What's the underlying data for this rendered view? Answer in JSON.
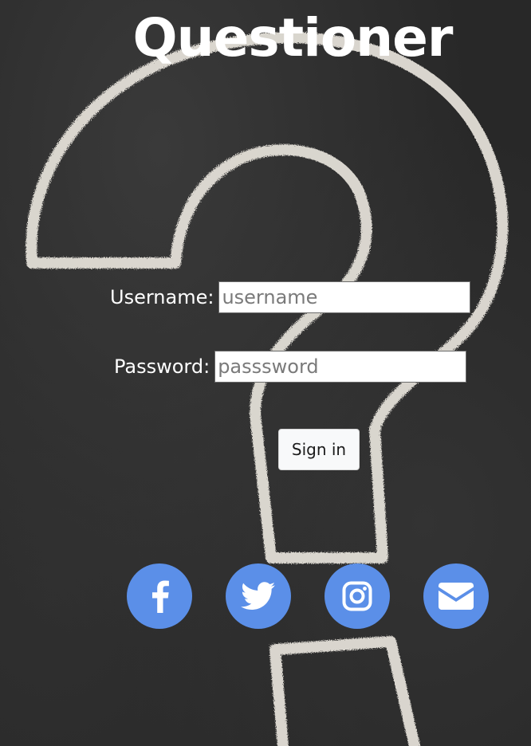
{
  "app": {
    "title": "Questioner"
  },
  "form": {
    "username_label": "Username:",
    "username_placeholder": "username",
    "username_value": "",
    "password_label": "Password:",
    "password_placeholder": "passsword",
    "password_value": "",
    "signin_label": "Sign in"
  },
  "social": [
    {
      "icon": "facebook-icon"
    },
    {
      "icon": "twitter-icon"
    },
    {
      "icon": "instagram-icon"
    },
    {
      "icon": "email-icon"
    }
  ],
  "colors": {
    "social_bg": "#5b8fe8",
    "title": "#ffffff",
    "chalk": "#e8e4dc"
  }
}
